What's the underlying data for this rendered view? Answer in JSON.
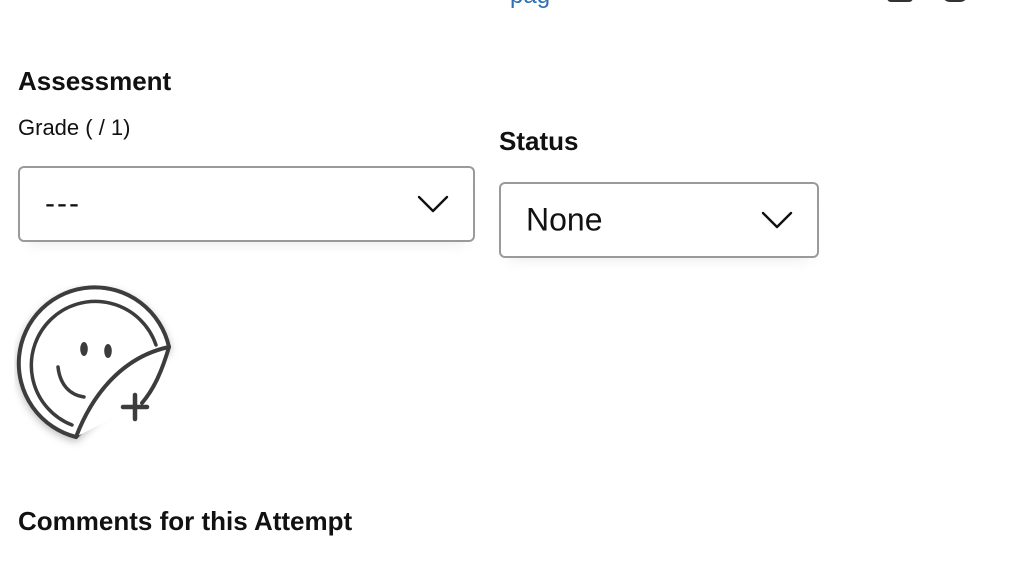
{
  "top": {
    "link_fragment": "pag"
  },
  "assessment": {
    "heading": "Assessment",
    "grade_label": "Grade ( / 1)",
    "grade_value": "---"
  },
  "status": {
    "heading": "Status",
    "value": "None"
  },
  "sticker": {
    "icon": "add-sticker-icon"
  },
  "comments": {
    "heading": "Comments for this Attempt"
  },
  "colors": {
    "link": "#2f6fb3",
    "border": "#9a9a9a",
    "text": "#111111"
  }
}
